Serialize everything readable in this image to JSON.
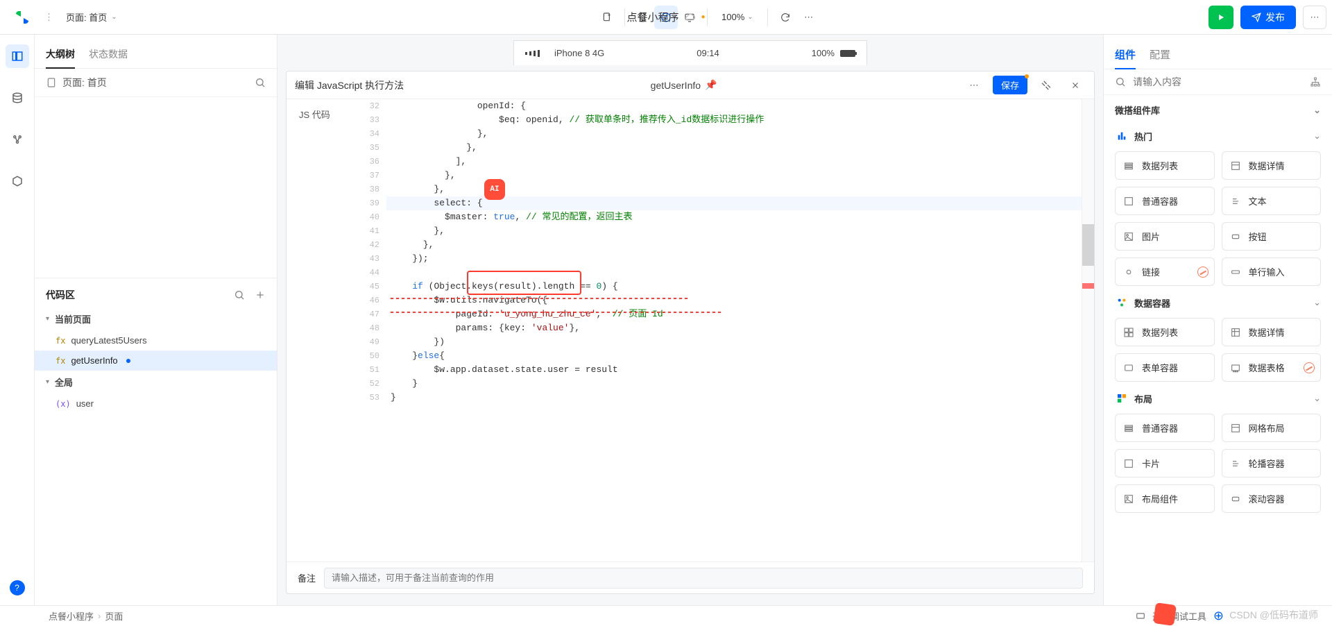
{
  "topbar": {
    "page_label": "页面: 首页",
    "zoom": "100%",
    "app_title": "点餐小程序",
    "publish": "发布"
  },
  "left": {
    "tabs": [
      "大纲树",
      "状态数据"
    ],
    "page_item": "页面: 首页",
    "code_area_title": "代码区",
    "cur_page": "当前页面",
    "file1": "queryLatest5Users",
    "file2": "getUserInfo",
    "global": "全局",
    "global1": "user"
  },
  "phone": {
    "device": "iPhone 8  4G",
    "time": "09:14",
    "battery": "100%"
  },
  "editor": {
    "title": "编辑 JavaScript 执行方法",
    "fname": "getUserInfo",
    "save": "保存",
    "side": "JS 代码",
    "remark_label": "备注",
    "remark_placeholder": "请输入描述，可用于备注当前查询的作用",
    "gutter_start": 32,
    "lines": [
      {
        "n": 32,
        "html": "                openId: {"
      },
      {
        "n": 33,
        "html": "                    $eq: openid, <span class='c-cmt'>// 获取单条时，推荐传入_id数据标识进行操作</span>"
      },
      {
        "n": 34,
        "html": "                },"
      },
      {
        "n": 35,
        "html": "              },"
      },
      {
        "n": 36,
        "html": "            ],"
      },
      {
        "n": 37,
        "html": "          },"
      },
      {
        "n": 38,
        "html": "        },"
      },
      {
        "n": 39,
        "html": "        select: {",
        "hl": true
      },
      {
        "n": 40,
        "html": "          $master: <span class='c-kw'>true</span>, <span class='c-cmt'>// 常见的配置，返回主表</span>"
      },
      {
        "n": 41,
        "html": "        },"
      },
      {
        "n": 42,
        "html": "      },"
      },
      {
        "n": 43,
        "html": "    });"
      },
      {
        "n": 44,
        "html": ""
      },
      {
        "n": 45,
        "html": "    <span class='c-kw'>if</span> (<span class='c-id'>Object</span>.keys(result).length == <span class='c-num'>0</span>) {"
      },
      {
        "n": 46,
        "html": "        $w.utils.navigateTo({"
      },
      {
        "n": 47,
        "html": "            pageId: <span class='c-str'>'u_yong_hu_zhu_ce'</span>,  <span class='c-cmt'>// 页面 Id</span>"
      },
      {
        "n": 48,
        "html": "            params: {<span class='c-id'>key</span>: <span class='c-str'>'value'</span>},"
      },
      {
        "n": 49,
        "html": "        })"
      },
      {
        "n": 50,
        "html": "    }<span class='c-kw'>else</span>{"
      },
      {
        "n": 51,
        "html": "        $w.app.dataset.state.user = result"
      },
      {
        "n": 52,
        "html": "    }"
      },
      {
        "n": 53,
        "html": "}"
      }
    ]
  },
  "right": {
    "tabs": [
      "组件",
      "配置"
    ],
    "search_placeholder": "请输入内容",
    "lib_title": "微搭组件库",
    "sections": [
      {
        "title": "热门",
        "icon": "hot",
        "items": [
          "数据列表",
          "数据详情",
          "普通容器",
          "文本",
          "图片",
          "按钮",
          "链接",
          "单行输入"
        ],
        "ban": [
          6
        ]
      },
      {
        "title": "数据容器",
        "icon": "data",
        "items": [
          "数据列表",
          "数据详情",
          "表单容器",
          "数据表格"
        ],
        "ban": [
          3
        ]
      },
      {
        "title": "布局",
        "icon": "layout",
        "items": [
          "普通容器",
          "网格布局",
          "卡片",
          "轮播容器",
          "布局组件",
          "滚动容器"
        ]
      }
    ]
  },
  "footer": {
    "crumb1": "点餐小程序",
    "crumb2": "页面",
    "devtools": "开发调试工具",
    "watermark": "CSDN @低码布道师"
  }
}
